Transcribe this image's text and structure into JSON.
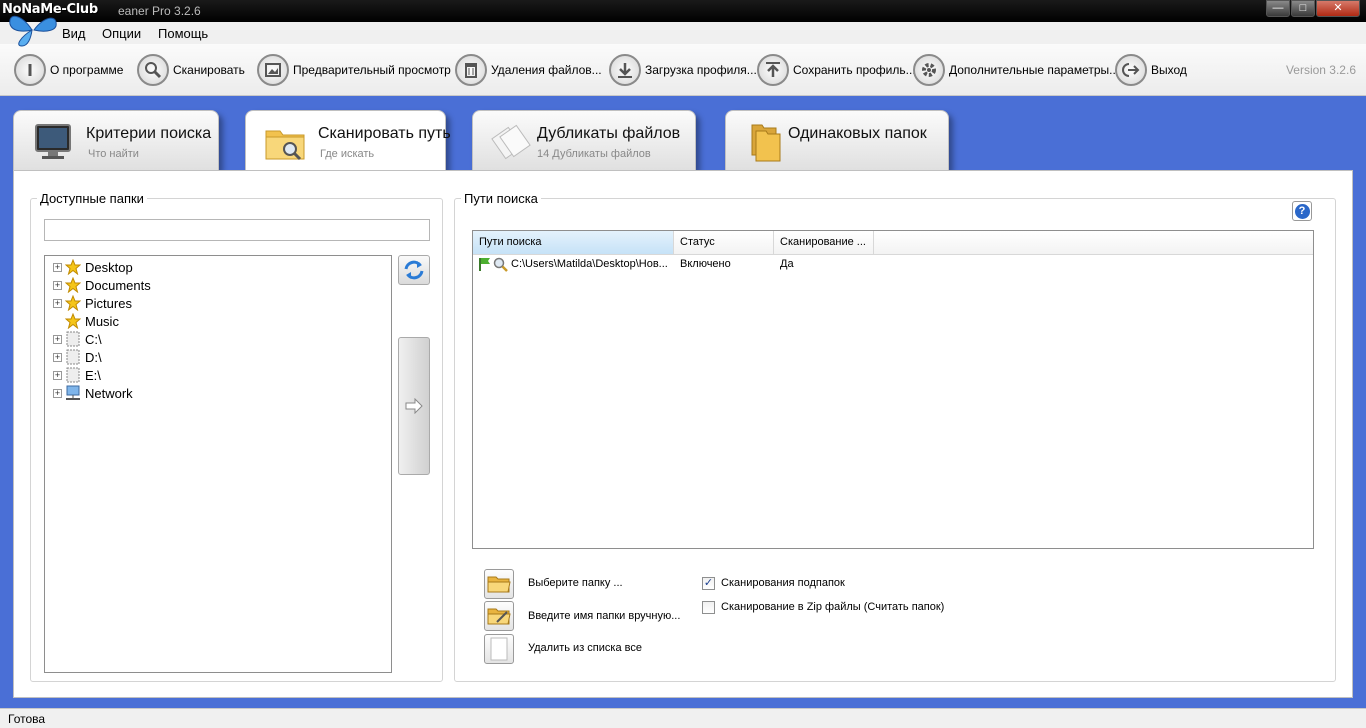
{
  "window": {
    "brand": "NoNaMe-Club",
    "title": "eaner Pro 3.2.6",
    "minimize": "—",
    "maximize": "□",
    "close": "✕"
  },
  "menu": [
    "Вид",
    "Опции",
    "Помощь"
  ],
  "toolbar": {
    "items": [
      {
        "label": "О программе",
        "icon": "info-icon"
      },
      {
        "label": "Сканировать",
        "icon": "search-icon"
      },
      {
        "label": "Предварительный просмотр",
        "icon": "preview-icon"
      },
      {
        "label": "Удаления файлов...",
        "icon": "trash-icon"
      },
      {
        "label": "Загрузка профиля...",
        "icon": "download-icon"
      },
      {
        "label": "Сохранить профиль...",
        "icon": "upload-icon"
      },
      {
        "label": "Дополнительные параметры...",
        "icon": "gear-icon"
      },
      {
        "label": "Выход",
        "icon": "exit-icon"
      }
    ],
    "version": "Version 3.2.6"
  },
  "tabs": [
    {
      "title": "Критерии поиска",
      "subtitle": "Что найти",
      "icon": "monitor-icon",
      "active": false
    },
    {
      "title": "Сканировать путь",
      "subtitle": "Где искать",
      "icon": "folder-search-icon",
      "active": true
    },
    {
      "title": "Дубликаты файлов",
      "subtitle": "14 Дубликаты файлов",
      "icon": "duplicate-files-icon",
      "active": false
    },
    {
      "title": "Одинаковых папок",
      "subtitle": "",
      "icon": "folders-icon",
      "active": false
    }
  ],
  "available_folders": {
    "label": "Доступные папки",
    "path_value": "",
    "tree": [
      {
        "label": "Desktop",
        "icon": "star-icon",
        "expandable": true
      },
      {
        "label": "Documents",
        "icon": "star-icon",
        "expandable": true
      },
      {
        "label": "Pictures",
        "icon": "star-icon",
        "expandable": true
      },
      {
        "label": "Music",
        "icon": "star-icon",
        "expandable": false
      },
      {
        "label": "C:\\",
        "icon": "drive-icon",
        "expandable": true
      },
      {
        "label": "D:\\",
        "icon": "drive-icon",
        "expandable": true
      },
      {
        "label": "E:\\",
        "icon": "drive-icon",
        "expandable": true
      },
      {
        "label": "Network",
        "icon": "network-icon",
        "expandable": true
      }
    ]
  },
  "search_paths": {
    "label": "Пути поиска",
    "help": "?",
    "columns": [
      "Пути поиска",
      "Статус",
      "Сканирование ..."
    ],
    "rows": [
      {
        "path": "C:\\Users\\Matilda\\Desktop\\Нов...",
        "status": "Включено",
        "scan": "Да"
      }
    ],
    "actions": [
      {
        "label": "Выберите папку ...",
        "icon": "folder-open-icon"
      },
      {
        "label": "Введите имя папки вручную...",
        "icon": "folder-edit-icon"
      },
      {
        "label": "Удалить из списка все",
        "icon": "clear-list-icon"
      }
    ],
    "options": [
      {
        "label": "Сканирования подпапок",
        "checked": true
      },
      {
        "label": "Сканирование в Zip файлы (Считать папок)",
        "checked": false
      }
    ]
  },
  "status": {
    "text": "Готова"
  },
  "colors": {
    "background": "#4a6fd6",
    "accent": "#2a67c9",
    "star": "#f5c518",
    "folder": "#f2c24e"
  }
}
